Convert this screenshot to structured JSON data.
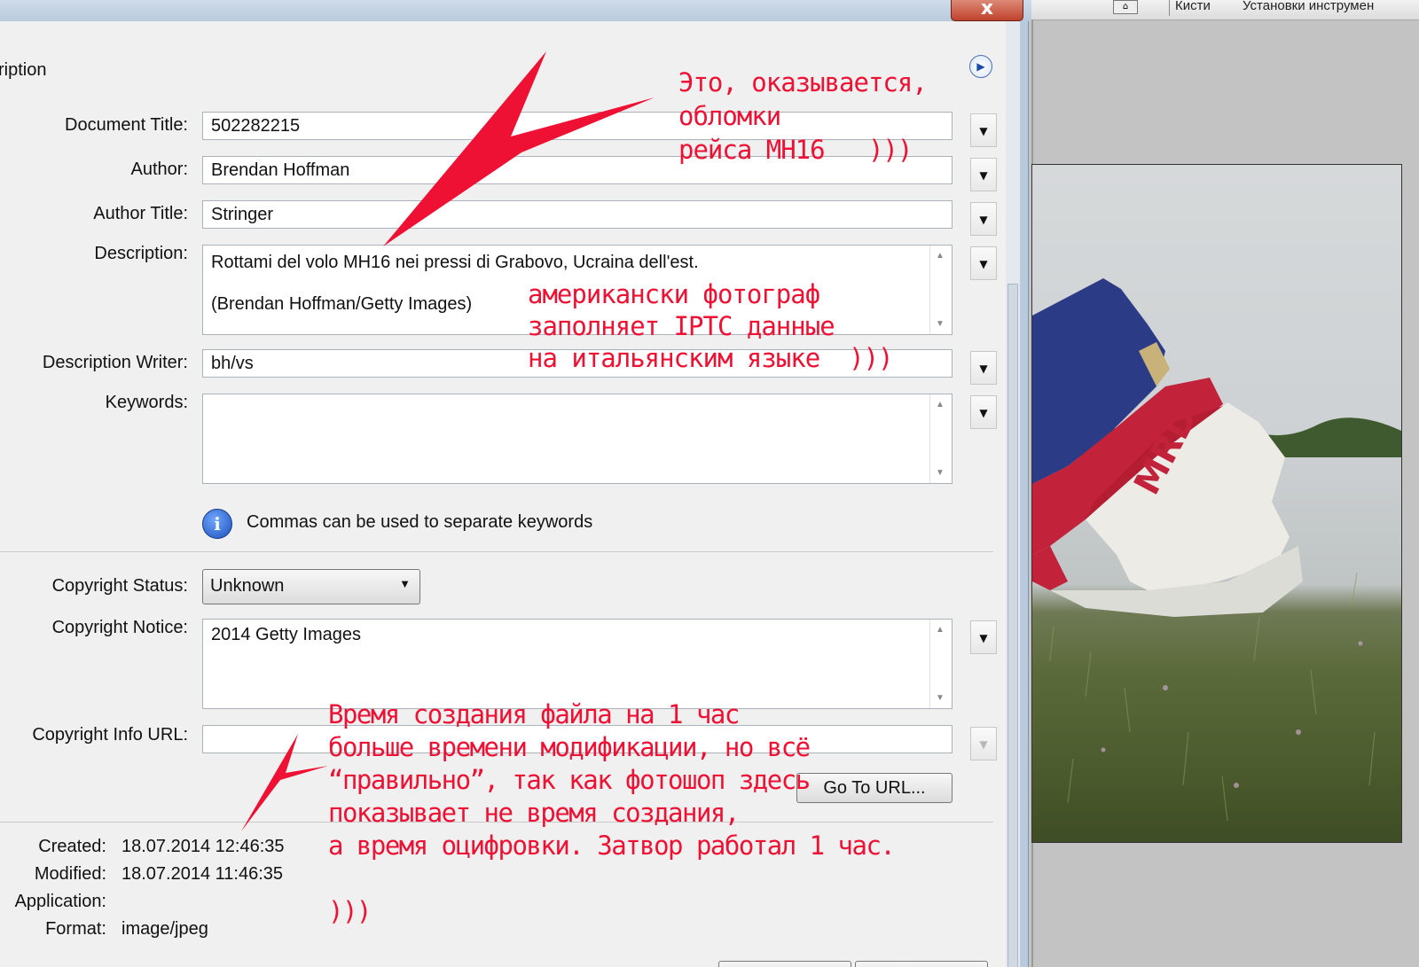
{
  "photoshop": {
    "tab_brushes": "Кисти",
    "tab_tool_presets": "Установки инструмен"
  },
  "dialog": {
    "close_label": "x",
    "section_title": "ription",
    "fields": {
      "document_title": {
        "label": "Document Title:",
        "value": "502282215"
      },
      "author": {
        "label": "Author:",
        "value": "Brendan Hoffman"
      },
      "author_title": {
        "label": "Author Title:",
        "value": "Stringer"
      },
      "description": {
        "label": "Description:",
        "line1": "Rottami del volo MH16 nei pressi di Grabovo, Ucraina dell'est.",
        "line2": "(Brendan Hoffman/Getty Images)"
      },
      "description_writer": {
        "label": "Description Writer:",
        "value": "bh/vs"
      },
      "keywords": {
        "label": "Keywords:",
        "value": ""
      },
      "copyright_status": {
        "label": "Copyright Status:",
        "value": "Unknown"
      },
      "copyright_notice": {
        "label": "Copyright Notice:",
        "value": "2014 Getty Images"
      },
      "copyright_info_url": {
        "label": "Copyright Info URL:",
        "value": ""
      }
    },
    "keywords_hint": "Commas can be used to separate keywords",
    "goto_url_label": "Go To URL...",
    "meta": {
      "created_label": "Created:",
      "created_value": "18.07.2014 12:46:35",
      "modified_label": "Modified:",
      "modified_value": "18.07.2014 11:46:35",
      "application_label": "Application:",
      "application_value": "",
      "format_label": "Format:",
      "format_value": "image/jpeg"
    }
  },
  "annotations": {
    "note_top": "Это, оказывается,\nобломки\nрейса МН16   )))",
    "note_middle": "американски фотограф\nзаполняет IPTC данные\nна итальянским языке  )))",
    "note_bottom": "Время создания файла на 1 час\nбольше времени модификации, но всё\n“правильно”, так как фотошоп здесь\nпоказывает не время создания,\nа время оцифровки. Затвор работал 1 час.\n\n)))"
  },
  "colors": {
    "annotation_red": "#ee1133",
    "dialog_panel": "#f0f0f0",
    "close_button": "#c0412c"
  }
}
